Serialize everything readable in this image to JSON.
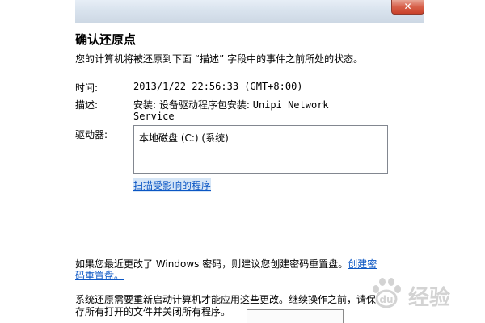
{
  "dialog": {
    "heading": "确认还原点",
    "description": "您的计算机将被还原到下面 “描述” 字段中的事件之前所处的状态。",
    "fields": {
      "time_label": "时间:",
      "time_value": "2013/1/22 22:56:33 (GMT+8:00)",
      "desc_label": "描述:",
      "desc_value_prefix": "安装: 设备驱动程序包安装: ",
      "desc_value_name": "Unipi Network",
      "desc_value_line2": "Service",
      "drives_label": "驱动器:"
    },
    "drives": [
      "本地磁盘 (C:) (系统)"
    ],
    "scan_link": "扫描受影响的程序",
    "password_note": "如果您最近更改了 Windows 密码，则建议您创建密码重置盘。",
    "password_link_line1": "创建密",
    "password_link_line2": "码重置盘。",
    "restart_note_line1": "系统还原需要重新启动计算机才能应用这些更改。继续操作之前，请保",
    "restart_note_line2": "存所有打开的文件并关闭所有程序。",
    "close_icon": "close-icon"
  },
  "watermark": {
    "text": "经验",
    "logo": "baidu-paw-logo"
  },
  "colors": {
    "link": "#0b56c4",
    "close_button": "#c9412a",
    "title_bar": "#d9e3ee"
  }
}
